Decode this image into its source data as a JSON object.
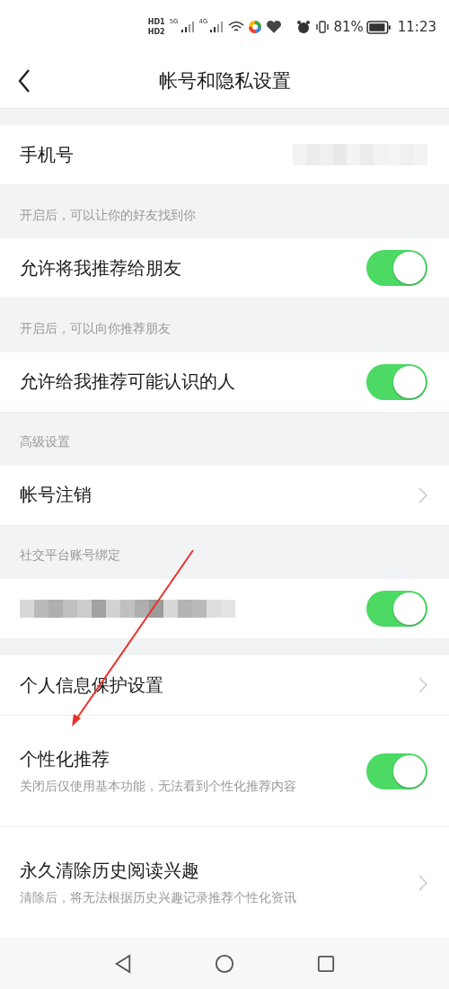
{
  "status_bar": {
    "sim_badges": [
      "HD1",
      "HD2"
    ],
    "networks": [
      "5G",
      "4G"
    ],
    "battery": "81%",
    "time": "11:23"
  },
  "header": {
    "title": "帐号和隐私设置"
  },
  "groups": [
    {
      "items": [
        {
          "kind": "value",
          "title": "手机号",
          "redacted": true
        }
      ]
    },
    {
      "label": "开启后，可以让你的好友找到你",
      "items": [
        {
          "kind": "toggle",
          "title": "允许将我推荐给朋友",
          "on": true
        }
      ]
    },
    {
      "label": "开启后，可以向你推荐朋友",
      "items": [
        {
          "kind": "toggle",
          "title": "允许给我推荐可能认识的人",
          "on": true
        }
      ]
    },
    {
      "label": "高级设置",
      "items": [
        {
          "kind": "link",
          "title": "帐号注销"
        }
      ]
    },
    {
      "label": "社交平台账号绑定",
      "items": [
        {
          "kind": "toggle",
          "redacted": true,
          "on": true
        }
      ]
    },
    {
      "items": [
        {
          "kind": "link",
          "title": "个人信息保护设置"
        },
        {
          "kind": "toggle",
          "title": "个性化推荐",
          "subtitle": "关闭后仅使用基本功能，无法看到个性化推荐内容",
          "on": true
        },
        {
          "kind": "link",
          "title": "永久清除历史阅读兴趣",
          "subtitle": "清除后，将无法根据历史兴趣记录推荐个性化资讯"
        }
      ]
    }
  ]
}
